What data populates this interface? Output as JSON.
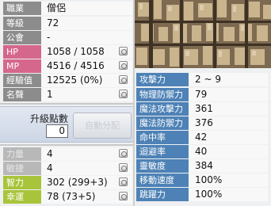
{
  "basic": [
    {
      "label": "職業",
      "value": "僧侶",
      "style": "gray"
    },
    {
      "label": "等級",
      "value": "72",
      "style": "gray"
    },
    {
      "label": "公會",
      "value": "-",
      "style": "gray"
    },
    {
      "label": "HP",
      "value": "1058 / 1058",
      "style": "pink",
      "button": true
    },
    {
      "label": "MP",
      "value": "4516 / 4516",
      "style": "pink",
      "button": true
    },
    {
      "label": "經驗值",
      "value": "12525 (0%)",
      "style": "gray",
      "button": true
    },
    {
      "label": "名聲",
      "value": "1",
      "style": "gray",
      "button": true
    }
  ],
  "ap": {
    "label": "升級點數",
    "value": "0",
    "auto_button": "自動分配"
  },
  "stats": [
    {
      "label": "力量",
      "value": "4",
      "style": "light",
      "button": true
    },
    {
      "label": "敏捷",
      "value": "4",
      "style": "light",
      "button": true
    },
    {
      "label": "智力",
      "value": "302 (299+3)",
      "style": "lime",
      "button": true
    },
    {
      "label": "幸運",
      "value": "78 (73+5)",
      "style": "lime",
      "button": true
    }
  ],
  "detail": [
    {
      "label": "攻擊力",
      "value": "2 ~ 9"
    },
    {
      "label": "物理防禦力",
      "value": "79"
    },
    {
      "label": "魔法攻擊力",
      "value": "361"
    },
    {
      "label": "魔法防禦力",
      "value": "376"
    },
    {
      "label": "命中率",
      "value": "42"
    },
    {
      "label": "迴避率",
      "value": "40"
    },
    {
      "label": "靈敏度",
      "value": "384"
    },
    {
      "label": "移動速度",
      "value": "100%"
    },
    {
      "label": "跳躍力",
      "value": "100%"
    }
  ],
  "colors": {
    "gray_tag": "#8c8c8c",
    "pink_tag": "#d6678c",
    "lime_tag": "#a8c43a",
    "blue_tag": "#4e82b6"
  }
}
